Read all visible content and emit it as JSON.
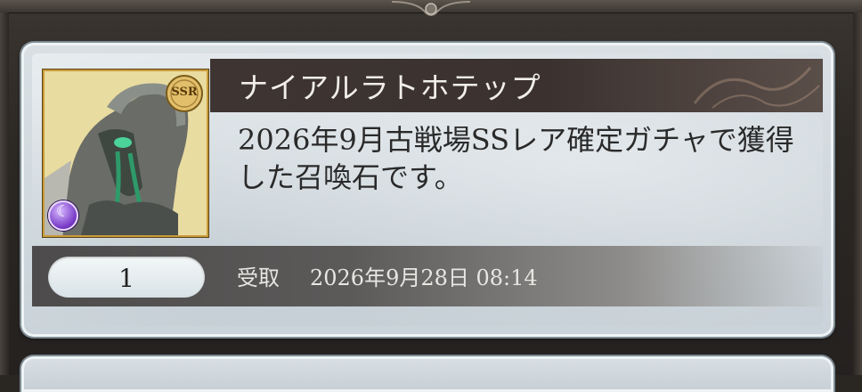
{
  "item": {
    "name": "ナイアルラトホテップ",
    "rarity": "SSR",
    "element_icon": "dark-element-icon",
    "description": "2026年9月古戦場SSレア確定ガチャで獲得した召喚石です。",
    "count": "1",
    "received_label": "受取",
    "received_date": "2026年9月28日 08:14"
  },
  "colors": {
    "title_bar": "#3b322f",
    "frame_gold": "#c89b3a",
    "card_bg": "#d9e0e4"
  }
}
